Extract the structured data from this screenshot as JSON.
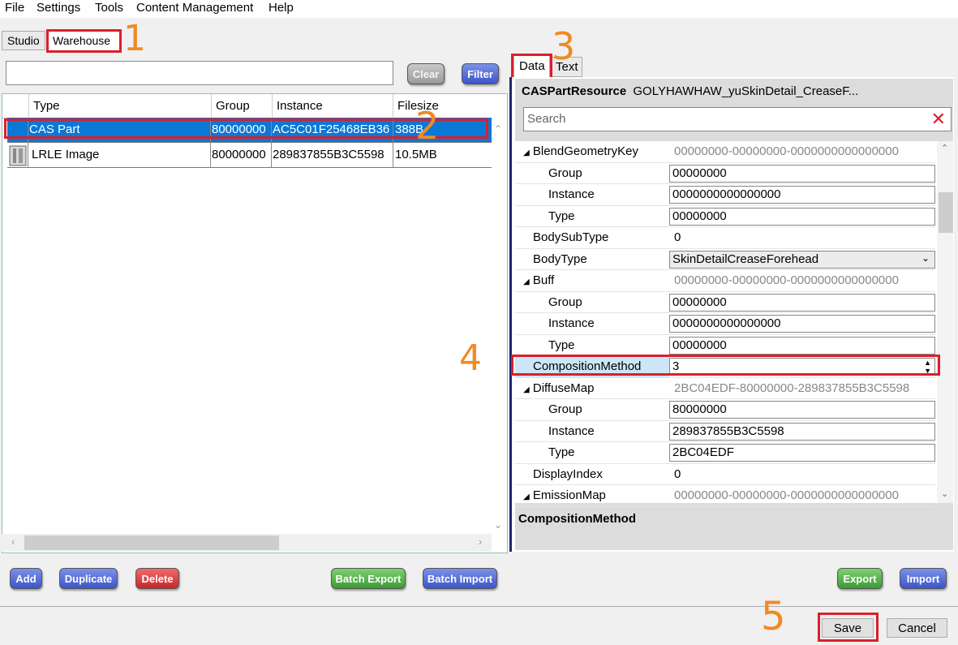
{
  "menu": [
    "File",
    "Settings",
    "Tools",
    "Content Management",
    "Help"
  ],
  "top_tabs": [
    "Studio",
    "Warehouse"
  ],
  "filter_bar": {
    "clear_label": "Clear",
    "filter_label": "Filter",
    "search_value": ""
  },
  "grid": {
    "columns": [
      "Type",
      "Group",
      "Instance",
      "Filesize"
    ],
    "rows": [
      {
        "type": "CAS Part",
        "group": "80000000",
        "instance": "AC5C01F25468EB36",
        "filesize": "388B"
      },
      {
        "type": "LRLE Image",
        "group": "80000000",
        "instance": "289837855B3C5598",
        "filesize": "10.5MB"
      }
    ]
  },
  "right_tabs": [
    "Data",
    "Text"
  ],
  "resource": {
    "kind": "CASPartResource",
    "name": "GOLYHAWHAW_yuSkinDetail_CreaseF..."
  },
  "prop_search_placeholder": "Search",
  "props": {
    "blend": {
      "name": "BlendGeometryKey",
      "value": "00000000-00000000-0000000000000000"
    },
    "blend_group": {
      "name": "Group",
      "value": "00000000"
    },
    "blend_instance": {
      "name": "Instance",
      "value": "0000000000000000"
    },
    "blend_type": {
      "name": "Type",
      "value": "00000000"
    },
    "bodysubtype": {
      "name": "BodySubType",
      "value": "0"
    },
    "bodytype": {
      "name": "BodyType",
      "value": "SkinDetailCreaseForehead"
    },
    "buff": {
      "name": "Buff",
      "value": "00000000-00000000-0000000000000000"
    },
    "buff_group": {
      "name": "Group",
      "value": "00000000"
    },
    "buff_instance": {
      "name": "Instance",
      "value": "0000000000000000"
    },
    "buff_type": {
      "name": "Type",
      "value": "00000000"
    },
    "composition": {
      "name": "CompositionMethod",
      "value": "3"
    },
    "diffuse": {
      "name": "DiffuseMap",
      "value": "2BC04EDF-80000000-289837855B3C5598"
    },
    "diffuse_group": {
      "name": "Group",
      "value": "80000000"
    },
    "diffuse_instance": {
      "name": "Instance",
      "value": "289837855B3C5598"
    },
    "diffuse_type": {
      "name": "Type",
      "value": "2BC04EDF"
    },
    "displayindex": {
      "name": "DisplayIndex",
      "value": "0"
    },
    "emission": {
      "name": "EmissionMap",
      "value": "00000000-00000000-0000000000000000"
    }
  },
  "description": "CompositionMethod",
  "actions": {
    "add": "Add",
    "duplicate": "Duplicate",
    "delete": "Delete",
    "batch_export": "Batch Export",
    "batch_import": "Batch Import",
    "export": "Export",
    "import": "Import"
  },
  "footer": {
    "save": "Save",
    "cancel": "Cancel"
  },
  "annotations": [
    "1",
    "2",
    "3",
    "4",
    "5"
  ],
  "colors": {
    "highlight": "#d9202c",
    "selection": "#0a78d7",
    "annotation": "#f08a24"
  }
}
